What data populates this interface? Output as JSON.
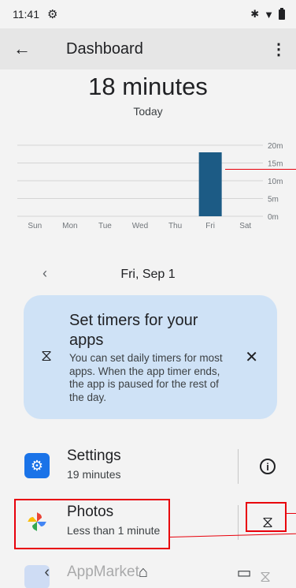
{
  "status_bar": {
    "time": "11:41"
  },
  "app_bar": {
    "title": "Dashboard"
  },
  "summary": {
    "total": "18 minutes",
    "period": "Today"
  },
  "chart_data": {
    "type": "bar",
    "categories": [
      "Sun",
      "Mon",
      "Tue",
      "Wed",
      "Thu",
      "Fri",
      "Sat"
    ],
    "values": [
      0,
      0,
      0,
      0,
      0,
      18,
      0
    ],
    "y_ticks": [
      "20m",
      "15m",
      "10m",
      "5m",
      "0m"
    ],
    "ylim": [
      0,
      20
    ],
    "bar_color": "#1c5b85",
    "grid": true
  },
  "date_nav": {
    "prev_icon": "chevron-left-icon",
    "date": "Fri, Sep 1"
  },
  "timer_card": {
    "title": "Set timers for your apps",
    "body": "You can set daily timers for most apps. When the app timer ends, the app is paused for the rest of the day.",
    "icon": "hourglass-icon",
    "close_icon": "close-icon"
  },
  "apps": [
    {
      "name": "Settings",
      "usage": "19 minutes",
      "action_icon": "info-icon"
    },
    {
      "name": "Photos",
      "usage": "Less than 1 minute",
      "action_icon": "hourglass-icon"
    }
  ],
  "faded_app": {
    "name": "AppMarket"
  },
  "colors": {
    "accent": "#1c5b85",
    "card_bg": "#cfe2f6",
    "highlight": "#e8000b"
  }
}
